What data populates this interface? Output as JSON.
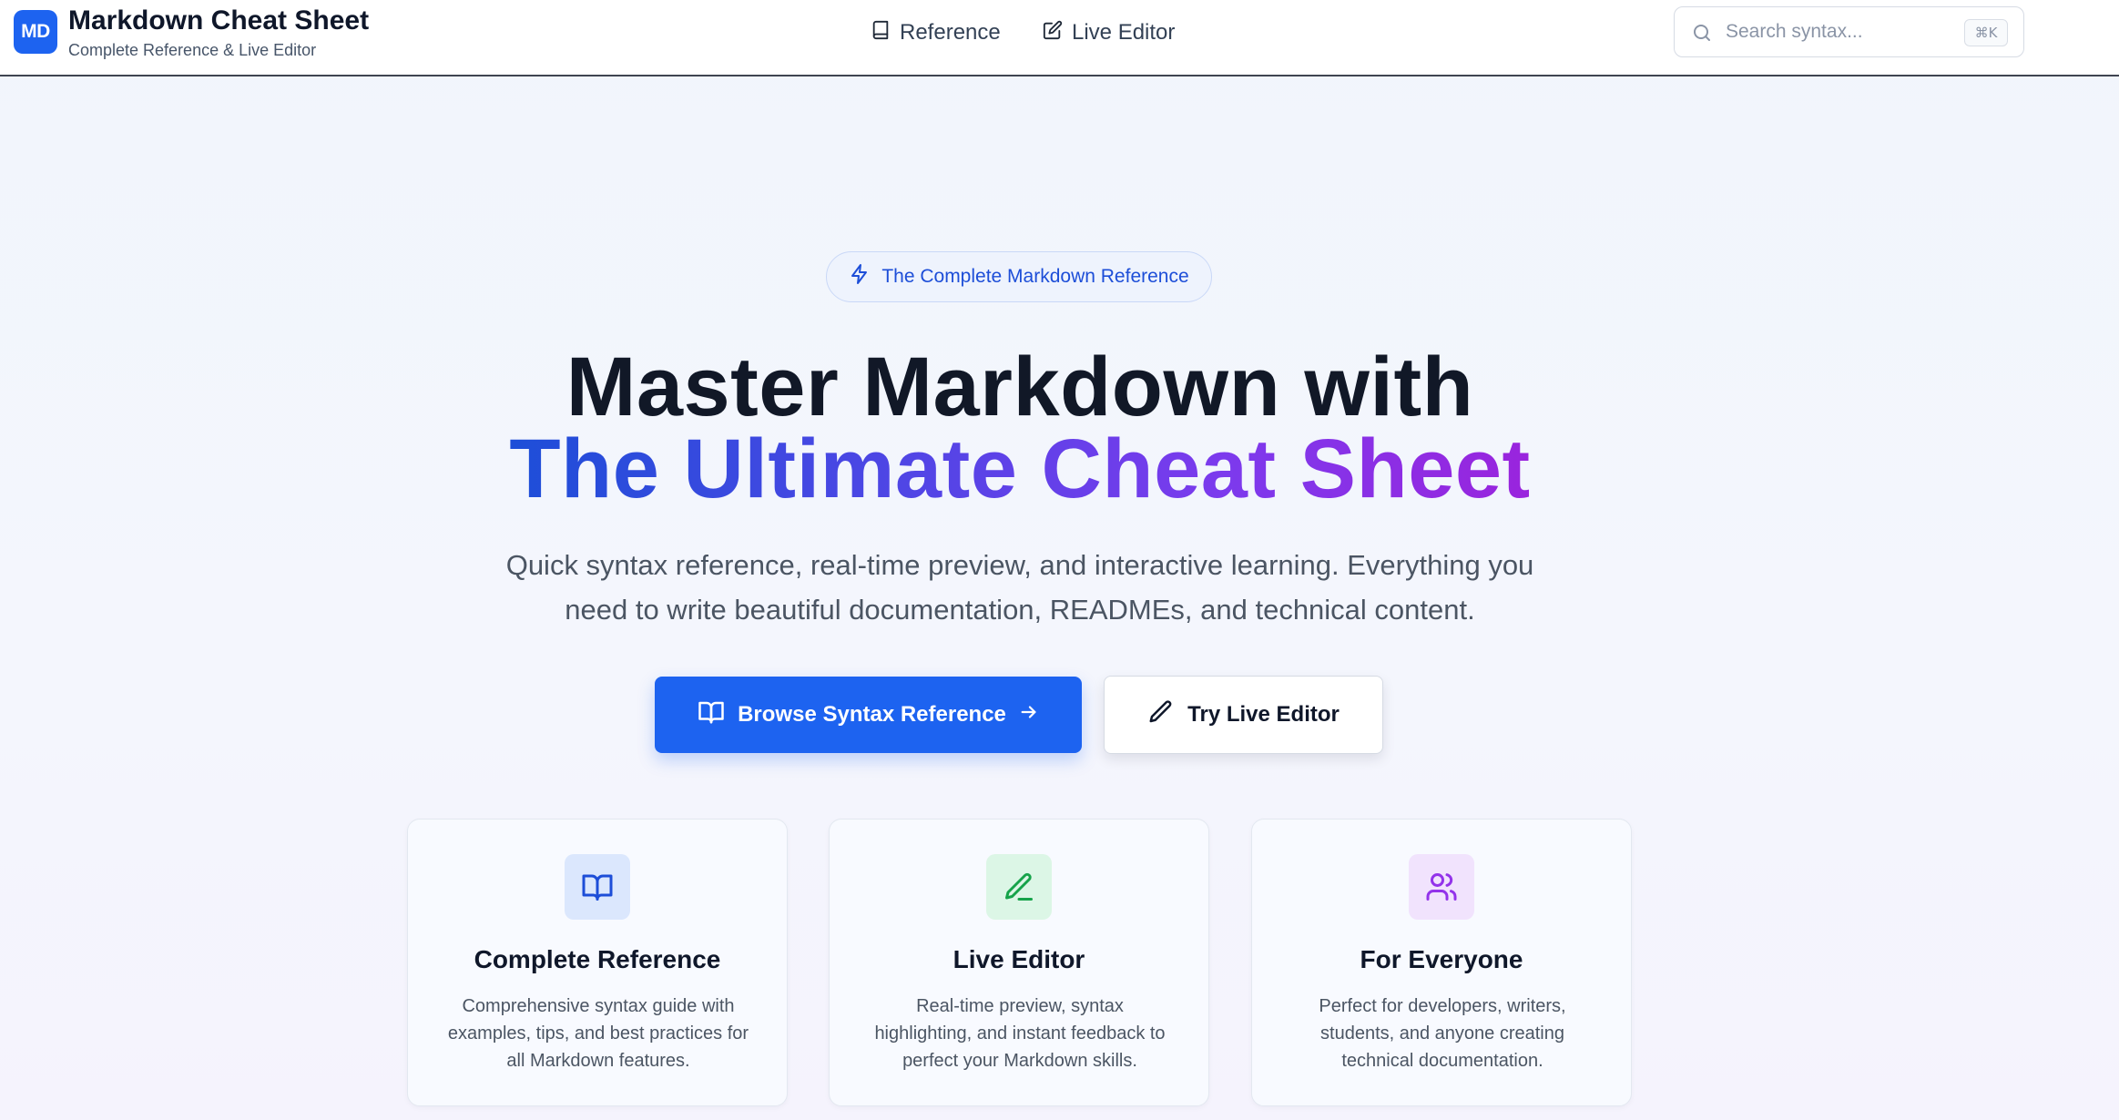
{
  "header": {
    "logo_text": "MD",
    "title": "Markdown Cheat Sheet",
    "subtitle": "Complete Reference & Live Editor",
    "nav": [
      {
        "label": "Reference",
        "icon": "book-icon"
      },
      {
        "label": "Live Editor",
        "icon": "edit-square-icon"
      }
    ],
    "search": {
      "placeholder": "Search syntax...",
      "value": "",
      "shortcut": "⌘K"
    }
  },
  "hero": {
    "badge": "The Complete Markdown Reference",
    "title_line1": "Master Markdown with",
    "title_line2": "The Ultimate Cheat Sheet",
    "description": "Quick syntax reference, real-time preview, and interactive learning. Everything you need to write beautiful documentation, READMEs, and technical content.",
    "primary_button": "Browse Syntax Reference",
    "secondary_button": "Try Live Editor"
  },
  "features": [
    {
      "title": "Complete Reference",
      "description": "Comprehensive syntax guide with examples, tips, and best practices for all Markdown features.",
      "icon": "book-open-icon",
      "color": "#1d4ed8"
    },
    {
      "title": "Live Editor",
      "description": "Real-time preview, syntax highlighting, and instant feedback to perfect your Markdown skills.",
      "icon": "pen-icon",
      "color": "#16a34a"
    },
    {
      "title": "For Everyone",
      "description": "Perfect for developers, writers, students, and anyone creating technical documentation.",
      "icon": "users-icon",
      "color": "#9333ea"
    }
  ],
  "colors": {
    "brand": "#1d63f0",
    "gradient": [
      "#1d4ed8",
      "#4f46e5",
      "#7c3aed",
      "#9a24dd"
    ]
  }
}
